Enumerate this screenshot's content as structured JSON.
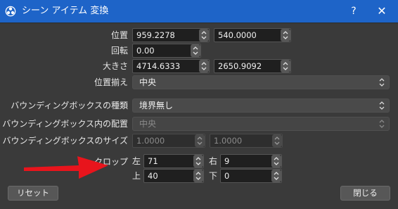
{
  "window": {
    "title": "シーン アイテム 変換",
    "help_label": "?",
    "close_label": "✕"
  },
  "position": {
    "label": "位置",
    "x": "959.2278",
    "y": "540.0000"
  },
  "rotation": {
    "label": "回転",
    "value": "0.00"
  },
  "size": {
    "label": "大きさ",
    "width": "4714.6333",
    "height": "2650.9092"
  },
  "alignment": {
    "label": "位置揃え",
    "value": "中央"
  },
  "bounds_type": {
    "label": "バウンディングボックスの種類",
    "value": "境界無し"
  },
  "bounds_alignment": {
    "label": "バウンディングボックス内の配置",
    "value": "中央"
  },
  "bounds_size": {
    "label": "バウンディングボックスのサイズ",
    "width": "1.0000",
    "height": "1.0000"
  },
  "crop": {
    "label": "クロップ",
    "left_label": "左",
    "left": "71",
    "right_label": "右",
    "right": "9",
    "top_label": "上",
    "top": "40",
    "bottom_label": "下",
    "bottom": "0"
  },
  "buttons": {
    "reset": "リセット",
    "close": "閉じる"
  },
  "colors": {
    "titlebar": "#1e64c8",
    "background": "#3a3a3a",
    "annotation_arrow": "#e8141c"
  },
  "icons": [
    "obs-logo-icon",
    "spin-up-down-icon",
    "combo-arrow-icon",
    "red-arrow-annotation"
  ]
}
